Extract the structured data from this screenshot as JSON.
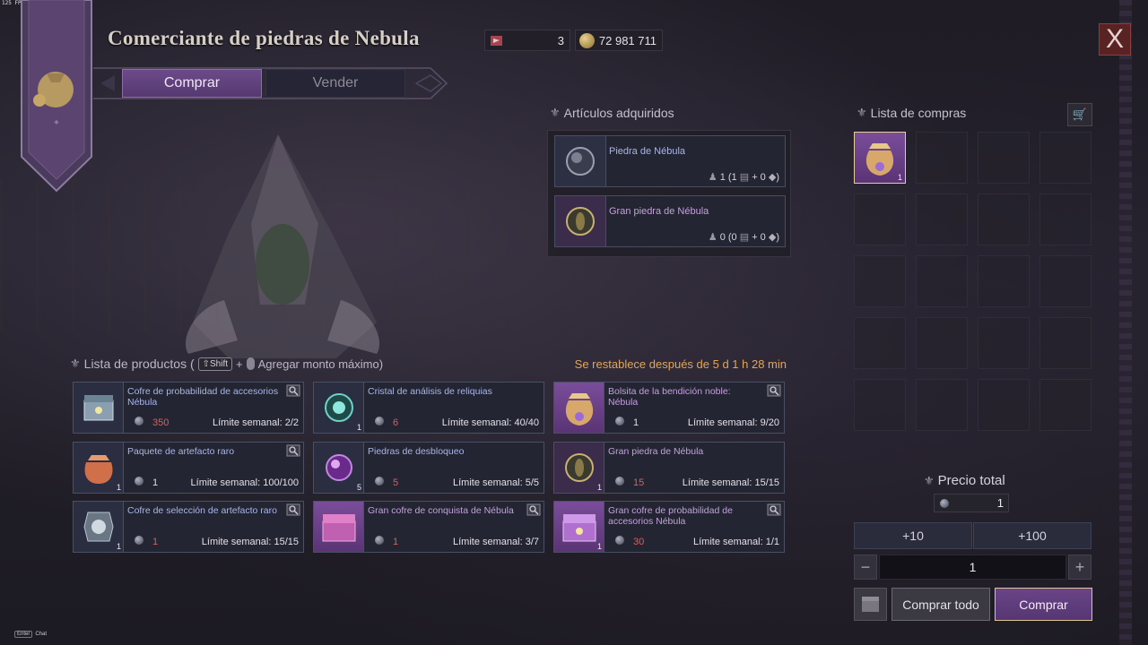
{
  "fps": "125 FPS",
  "header": {
    "title": "Comerciante de piedras de Nebula",
    "currency_1": "3",
    "currency_2": "72 981 711",
    "close_label": "X"
  },
  "tabs": [
    {
      "label": "Comprar",
      "active": true
    },
    {
      "label": "Vender",
      "active": false
    }
  ],
  "acquired": {
    "title": "Artículos adquiridos",
    "items": [
      {
        "name": "Piedra de Nébula",
        "count": "1 (1",
        "plus": "+ 0",
        "close": ")",
        "color": "blue"
      },
      {
        "name": "Gran piedra de Nébula",
        "count": "0 (0",
        "plus": "+ 0",
        "close": ")",
        "color": "purple"
      }
    ]
  },
  "cart": {
    "title": "Lista de compras",
    "filled_slot_qty": "1"
  },
  "products": {
    "title": "Lista de productos (",
    "shift": "Shift",
    "plus": "+",
    "hint": "Agregar monto máximo)",
    "reset": "Se restablece después de 5 d 1 h 28 min",
    "items": [
      {
        "name": "Cofre de probabilidad de accesorios Nébula",
        "price": "350",
        "limit": "Límite semanal: 2/2",
        "qty": "",
        "name_color": "blue",
        "price_red": true
      },
      {
        "name": "Cristal de análisis de reliquias",
        "price": "6",
        "limit": "Límite semanal: 40/40",
        "qty": "1",
        "name_color": "blue",
        "price_red": true
      },
      {
        "name": "Bolsita de la bendición noble: Nébula",
        "price": "1",
        "limit": "Límite semanal: 9/20",
        "qty": "",
        "name_color": "purple",
        "price_red": false
      },
      {
        "name": "Paquete de artefacto raro",
        "price": "1",
        "limit": "Límite semanal: 100/100",
        "qty": "1",
        "name_color": "blue",
        "price_red": false
      },
      {
        "name": "Piedras de desbloqueo",
        "price": "5",
        "limit": "Límite semanal: 5/5",
        "qty": "5",
        "name_color": "blue",
        "price_red": true
      },
      {
        "name": "Gran piedra de Nébula",
        "price": "15",
        "limit": "Límite semanal: 15/15",
        "qty": "1",
        "name_color": "purple",
        "price_red": true
      },
      {
        "name": "Cofre de selección de artefacto raro",
        "price": "1",
        "limit": "Límite semanal: 15/15",
        "qty": "1",
        "name_color": "blue",
        "price_red": true
      },
      {
        "name": "Gran cofre de conquista de Nébula",
        "price": "1",
        "limit": "Límite semanal: 3/7",
        "qty": "",
        "name_color": "purple",
        "price_red": true
      },
      {
        "name": "Gran cofre de probabilidad de accesorios Nébula",
        "price": "30",
        "limit": "Límite semanal: 1/1",
        "qty": "1",
        "name_color": "purple",
        "price_red": true
      }
    ]
  },
  "totals": {
    "title": "Precio total",
    "value": "1",
    "plus10": "+10",
    "plus100": "+100",
    "minus": "−",
    "qty": "1",
    "plus_sym": "+",
    "buy_all": "Comprar todo",
    "buy": "Comprar"
  },
  "chat": {
    "key": "Enter",
    "label": "Chat"
  },
  "colors": {
    "accent_purple": "#6c4a8a",
    "price_red": "#df5c5c",
    "reset_orange": "#e0a65a",
    "name_blue": "#a9b6e8",
    "name_purple": "#c4a0dc"
  }
}
